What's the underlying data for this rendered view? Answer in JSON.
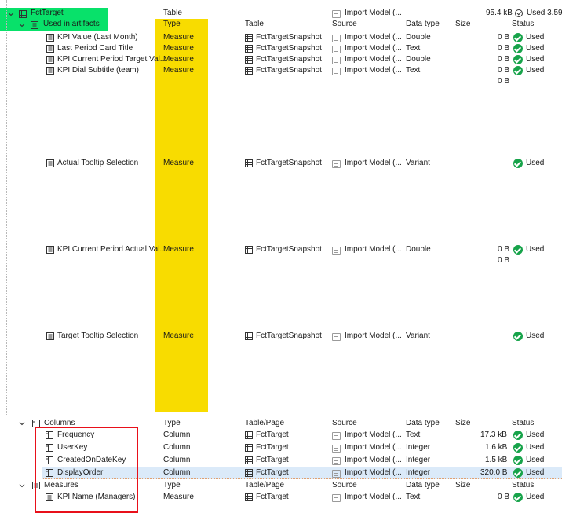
{
  "root": {
    "name": "FctTarget",
    "type": "Table",
    "source": "Import Model (...",
    "size": "95.4 kB",
    "status": "Used 3.59"
  },
  "artifacts": {
    "label": "Used in artifacts",
    "headers": {
      "type": "Type",
      "table": "Table",
      "source": "Source",
      "datatype": "Data type",
      "size": "Size",
      "status": "Status"
    },
    "rows": [
      {
        "name": "KPI Value (Last Month)",
        "type": "Measure",
        "table": "FctTargetSnapshot",
        "source": "Import Model (...",
        "datatype": "Double",
        "size": "0 B",
        "status": "Used",
        "extra": ""
      },
      {
        "name": "Last Period Card Title",
        "type": "Measure",
        "table": "FctTargetSnapshot",
        "source": "Import Model (...",
        "datatype": "Text",
        "size": "0 B",
        "status": "Used",
        "extra": ""
      },
      {
        "name": "KPI Current Period Target Val...",
        "type": "Measure",
        "table": "FctTargetSnapshot",
        "source": "Import Model (...",
        "datatype": "Double",
        "size": "0 B",
        "status": "Used",
        "extra": ""
      },
      {
        "name": "KPI Dial Subtitle (team)",
        "type": "Measure",
        "table": "FctTargetSnapshot",
        "source": "Import Model (...",
        "datatype": "Text",
        "size": "0 B",
        "status": "Used",
        "extra": "0 B"
      },
      {
        "name": "Actual Tooltip Selection",
        "type": "Measure",
        "table": "FctTargetSnapshot",
        "source": "Import Model (...",
        "datatype": "Variant",
        "size": "",
        "status": "Used",
        "extra": ""
      },
      {
        "name": "KPI Current Period Actual Val...",
        "type": "Measure",
        "table": "FctTargetSnapshot",
        "source": "Import Model (...",
        "datatype": "Double",
        "size": "0 B",
        "status": "Used",
        "extra": "0 B"
      },
      {
        "name": "Target Tooltip Selection",
        "type": "Measure",
        "table": "FctTargetSnapshot",
        "source": "Import Model (...",
        "datatype": "Variant",
        "size": "",
        "status": "Used",
        "extra": ""
      }
    ]
  },
  "columns": {
    "label": "Columns",
    "headers": {
      "type": "Type",
      "table": "Table/Page",
      "source": "Source",
      "datatype": "Data type",
      "size": "Size",
      "status": "Status"
    },
    "rows": [
      {
        "name": "Frequency",
        "type": "Column",
        "table": "FctTarget",
        "source": "Import Model (...",
        "datatype": "Text",
        "size": "17.3 kB",
        "status": "Used"
      },
      {
        "name": "UserKey",
        "type": "Column",
        "table": "FctTarget",
        "source": "Import Model (...",
        "datatype": "Integer",
        "size": "1.6 kB",
        "status": "Used"
      },
      {
        "name": "CreatedOnDateKey",
        "type": "Column",
        "table": "FctTarget",
        "source": "Import Model (...",
        "datatype": "Integer",
        "size": "1.5 kB",
        "status": "Used"
      },
      {
        "name": "DisplayOrder",
        "type": "Column",
        "table": "FctTarget",
        "source": "Import Model (...",
        "datatype": "Integer",
        "size": "320.0 B",
        "status": "Used"
      }
    ]
  },
  "measures": {
    "label": "Measures",
    "headers": {
      "type": "Type",
      "table": "Table/Page",
      "source": "Source",
      "datatype": "Data type",
      "size": "Size",
      "status": "Status"
    },
    "rows": [
      {
        "name": "KPI Name (Managers)",
        "type": "Measure",
        "table": "FctTarget",
        "source": "Import Model (...",
        "datatype": "Text",
        "size": "0 B",
        "status": "Used"
      }
    ]
  },
  "colors": {
    "green_highlight": "#08e16a",
    "yellow_highlight": "#f8dc00",
    "red_box": "#e8101a",
    "used_check": "#17a34a",
    "selection": "#dbeaf9"
  }
}
